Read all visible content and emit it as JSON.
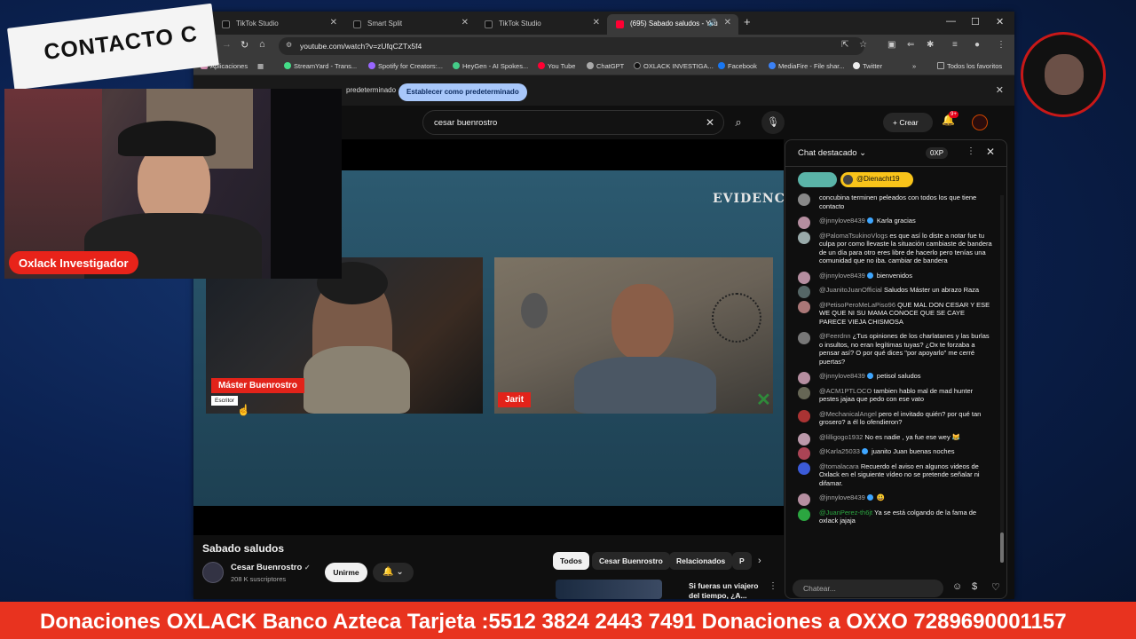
{
  "browser": {
    "tabs": [
      {
        "label": "TikTok Studio"
      },
      {
        "label": "Smart Split"
      },
      {
        "label": "TikTok Studio"
      },
      {
        "label": "(695) Sabado saludos - You"
      }
    ],
    "url": "youtube.com/watch?v=zUfqCZTx5f4",
    "bookmarks": [
      "Aplicaciones",
      "StreamYard - Trans...",
      "Spotify for Creators:...",
      "HeyGen - AI Spokes...",
      "You Tube",
      "ChatGPT",
      "OXLACK INVESTIGA...",
      "Facebook",
      "MediaFire - File shar...",
      "Twitter",
      "Todos los favoritos"
    ],
    "infobar": {
      "text": "predeterminado",
      "button": "Establecer como predeterminado"
    }
  },
  "youtube": {
    "search_value": "cesar buenrostro",
    "create_label": "Crear",
    "notif_badge": "9+",
    "video": {
      "brand": "EVIDENCIA",
      "left_name": "Máster Buenrostro",
      "left_sub": "Escritor",
      "right_name": "Jarit"
    },
    "title": "Sabado saludos",
    "channel": "Cesar Buenrostro",
    "subscribers": "208 K suscriptores",
    "join_label": "Unirme",
    "chips": [
      "Todos",
      "Cesar Buenrostro",
      "Relacionados",
      "P"
    ],
    "rec_title": "Si fueras un viajero del tiempo, ¿A..."
  },
  "chat": {
    "header": "Chat destacado",
    "xp": "0XP",
    "pinned_user": "@Dienacht19",
    "messages": [
      {
        "author": "",
        "text": "concubina terminen peleados con todos los que tiene contacto",
        "av": "#888"
      },
      {
        "author": "@jnnylove8439",
        "text": "Karla gracias",
        "av": "#b58ea0",
        "kind": "mod"
      },
      {
        "author": "@PalomaTsukinoVlogs",
        "text": "es que así lo diste a notar fue tu culpa por como llevaste la situación cambiaste de bandera de un día para otro eres libre de hacerlo pero tenías una comunidad que no iba. cambiar de bandera",
        "av": "#9aa"
      },
      {
        "author": "@jnnylove8439",
        "text": "bienvenidos",
        "av": "#b58ea0",
        "kind": "mod"
      },
      {
        "author": "@JuanitoJuanOfficial",
        "text": "Saludos Máster un abrazo Raza",
        "av": "#566"
      },
      {
        "author": "@PetisoPeroMeLaPiso96",
        "text": "QUE MAL DON CESAR Y ESE WE QUE NI SU MAMA CONOCE QUE SE CAYE PARECE VIEJA CHISMOSA",
        "av": "#a77"
      },
      {
        "author": "@Feerdnn",
        "text": "¿Tus opiniones de los charlatanes y las burlas o insultos, no eran legítimas tuyas? ¿Ox te forzaba a pensar así? O por qué dices \"por apoyarlo\" me cerré puertas?",
        "av": "#777"
      },
      {
        "author": "@jnnylove8439",
        "text": "petisol saludos",
        "av": "#b58ea0",
        "kind": "mod"
      },
      {
        "author": "@ACM1PTLOCO",
        "text": "tambien hablo mal de mad hunter pestes jajaa que pedo con ese vato",
        "av": "#665"
      },
      {
        "author": "@MechanicalAngel",
        "text": "pero el invitado quién? por qué tan grosero? a él lo ofendieron?",
        "av": "#a33"
      },
      {
        "author": "@lilligogo1932",
        "text": "No es nadie , ya fue ese wey 😹",
        "av": "#b9a"
      },
      {
        "author": "@Karla25033",
        "text": "juanito Juan buenas noches",
        "av": "#a45",
        "kind": "mod"
      },
      {
        "author": "@tomalacara",
        "text": "Recuerdo el aviso en algunos videos de Oxlack en el siguiente vídeo no se pretende señalar ni difamar.",
        "av": "#3b5bd9"
      },
      {
        "author": "@jnnylove8439",
        "text": "😃",
        "av": "#b58ea0",
        "kind": "mod"
      },
      {
        "author": "@JuanPerez-th6jt",
        "text": "Ya se está colgando de la fama de oxlack jajaja",
        "av": "#2ba640",
        "kind": "mem"
      }
    ],
    "input_placeholder": "Chatear..."
  },
  "overlay": {
    "banner": "CONTACTO C",
    "streamer_label": "Oxlack Investigador",
    "ticker": "Donaciones OXLACK Banco Azteca Tarjeta :5512 3824 2443 7491 Donaciones a OXXO 7289690001157"
  },
  "colors": {
    "ticker_bg": "#e8331f",
    "youtube_red": "#ff0033",
    "lower_third_red": "#e2231a"
  }
}
